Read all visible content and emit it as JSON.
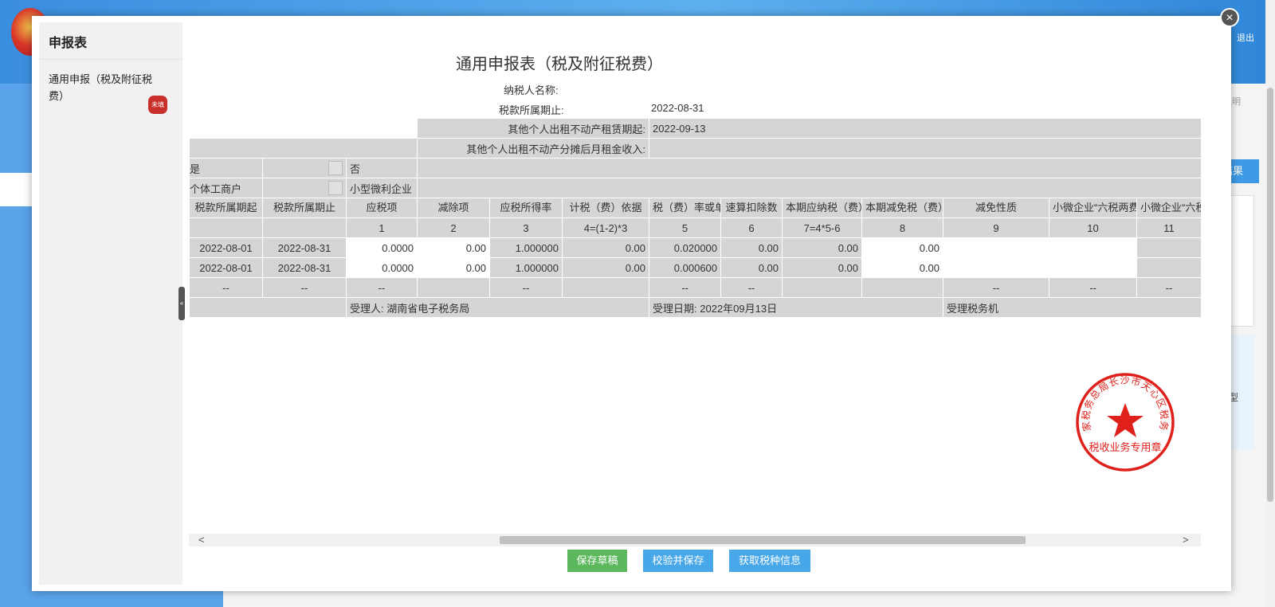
{
  "background": {
    "exit_label": "退出",
    "right_text": "说明",
    "result_btn": "结果",
    "card_text": "型"
  },
  "modal": {
    "close_icon": "×",
    "sidebar": {
      "title": "申报表",
      "item_label": "通用申报（税及附征税费）",
      "item_badge": "未填",
      "collapse_glyph": "«"
    },
    "form": {
      "title": "通用申报表（税及附征税费）",
      "taxpayer_name_label": "纳税人名称:",
      "taxpayer_name_value": "",
      "period_end_label": "税款所属期止:",
      "period_end_value": "2022-08-31",
      "rental_start_label": "其他个人出租不动产租赁期起:",
      "rental_start_value": "2022-09-13",
      "rental_income_label": "其他个人出租不动产分摊后月租金收入:",
      "opt_yes_partial": "是",
      "opt_no": "否",
      "opt_individual_partial": "个体工商户",
      "opt_small_micro": "小型微利企业",
      "columns": [
        {
          "label": "税款所属期起",
          "index": ""
        },
        {
          "label": "税款所属期止",
          "index": ""
        },
        {
          "label": "应税项",
          "index": "1"
        },
        {
          "label": "减除项",
          "index": "2"
        },
        {
          "label": "应税所得率",
          "index": "3"
        },
        {
          "label": "计税（费）依据",
          "index": "4=(1-2)*3"
        },
        {
          "label": "税（费）率或单位税额",
          "index": "5"
        },
        {
          "label": "速算扣除数",
          "index": "6"
        },
        {
          "label": "本期应纳税（费）额",
          "index": "7=4*5-6"
        },
        {
          "label": "本期减免税（费）额",
          "index": "8"
        },
        {
          "label": "减免性质",
          "index": "9"
        },
        {
          "label": "小微企业“六税两费”减免性质",
          "index": "10"
        },
        {
          "label": "小微企业“六税两费”减征比例(%)",
          "index": "11"
        }
      ],
      "rows": [
        [
          "2022-08-01",
          "2022-08-31",
          "0.0000",
          "0.00",
          "1.000000",
          "0.00",
          "0.020000",
          "0.00",
          "0.00",
          "0.00",
          "",
          "",
          ""
        ],
        [
          "2022-08-01",
          "2022-08-31",
          "0.0000",
          "0.00",
          "1.000000",
          "0.00",
          "0.000600",
          "0.00",
          "0.00",
          "0.00",
          "",
          "",
          ""
        ]
      ],
      "total_row": [
        "--",
        "--",
        "--",
        "",
        "--",
        "",
        "--",
        "--",
        "",
        "",
        "--",
        "--",
        "--"
      ],
      "footer": {
        "receiver": "受理人: 湖南省电子税务局",
        "receive_date": "受理日期: 2022年09月13日",
        "tax_office_partial": "受理税务机"
      },
      "stamp": {
        "top_text": "国家税务总局长沙市天心区税务局",
        "bottom_text": "税收业务专用章"
      }
    },
    "buttons": {
      "save_draft": "保存草稿",
      "verify_save": "校验并保存",
      "fetch_tax_info": "获取税种信息"
    }
  },
  "colors": {
    "accent_blue": "#48a7e8",
    "save_green": "#5cb85c",
    "badge_red": "#c9302c",
    "stamp_red": "#e0201b",
    "cell_gray": "#d5d5d5"
  }
}
